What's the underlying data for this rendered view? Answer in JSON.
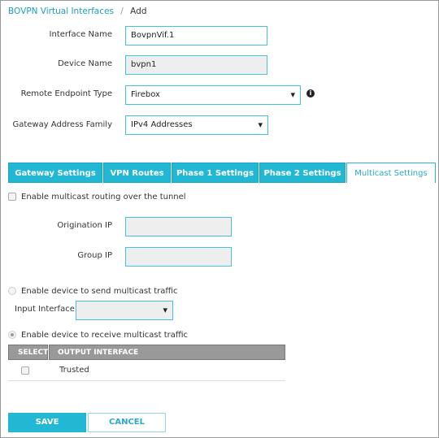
{
  "breadcrumb": {
    "parent": "BOVPN Virtual Interfaces",
    "separator": "/",
    "current": "Add"
  },
  "form": {
    "interface_name": {
      "label": "Interface Name",
      "value": "BovpnVif.1"
    },
    "device_name": {
      "label": "Device Name",
      "value": "bvpn1"
    },
    "remote_endpoint_type": {
      "label": "Remote Endpoint Type",
      "value": "Firebox"
    },
    "gateway_address_family": {
      "label": "Gateway Address Family",
      "value": "IPv4 Addresses"
    }
  },
  "tabs": [
    {
      "label": "Gateway Settings"
    },
    {
      "label": "VPN Routes"
    },
    {
      "label": "Phase 1 Settings"
    },
    {
      "label": "Phase 2 Settings"
    },
    {
      "label": "Multicast Settings",
      "active": true
    }
  ],
  "multicast": {
    "enable_label": "Enable multicast routing over the tunnel",
    "enable_checked": false,
    "origination_ip_label": "Origination IP",
    "origination_ip": "",
    "group_ip_label": "Group IP",
    "group_ip": "",
    "send_label": "Enable device to send multicast traffic",
    "input_interface_label": "Input Interface",
    "input_interface": "",
    "receive_label": "Enable device to receive multicast traffic",
    "receive_selected": true,
    "table": {
      "headers": [
        "SELECT",
        "OUTPUT INTERFACE"
      ],
      "rows": [
        {
          "selected": false,
          "interface": "Trusted"
        }
      ]
    }
  },
  "buttons": {
    "save": "SAVE",
    "cancel": "CANCEL"
  },
  "colors": {
    "accent": "#22b8d4",
    "link": "#1a9ec2",
    "header_grey": "#999999"
  }
}
